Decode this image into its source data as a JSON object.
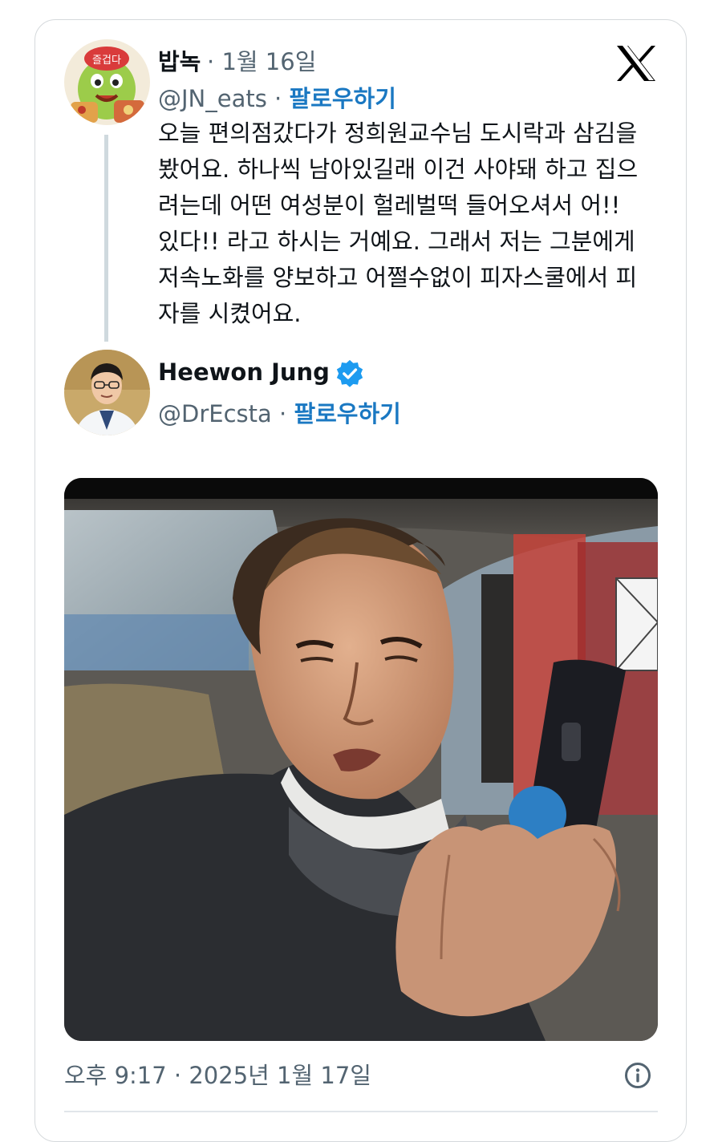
{
  "reply": {
    "display_name": "밥녹",
    "date": "1월 16일",
    "handle": "@JN_eats",
    "follow_label": "팔로우하기",
    "avatar_text": "즐겁다",
    "text": "오늘 편의점갔다가 정희원교수님 도시락과 삼김을\n봤어요. 하나씩 남아있길래 이건 사야돼 하고 집으\n려는데 어떤 여성분이 헐레벌떡 들어오셔서 어!!\n있다!! 라고 하시는 거예요. 그래서 저는 그분에게\n저속노화를 양보하고 어쩔수없이 피자스쿨에서 피\n자를 시켰어요."
  },
  "author": {
    "display_name": "Heewon Jung",
    "handle": "@DrEcsta",
    "follow_label": "팔로우하기"
  },
  "footer": {
    "timestamp": "오후 9:17 · 2025년 1월 17일"
  },
  "separator": " · ",
  "icons": {
    "logo": "x-logo-icon",
    "verified": "verified-badge-icon",
    "info": "info-icon"
  },
  "colors": {
    "follow": "#1a78c2",
    "verified": "#1d9bf0",
    "secondary_text": "#536471",
    "thread_line": "#cfd9de"
  }
}
